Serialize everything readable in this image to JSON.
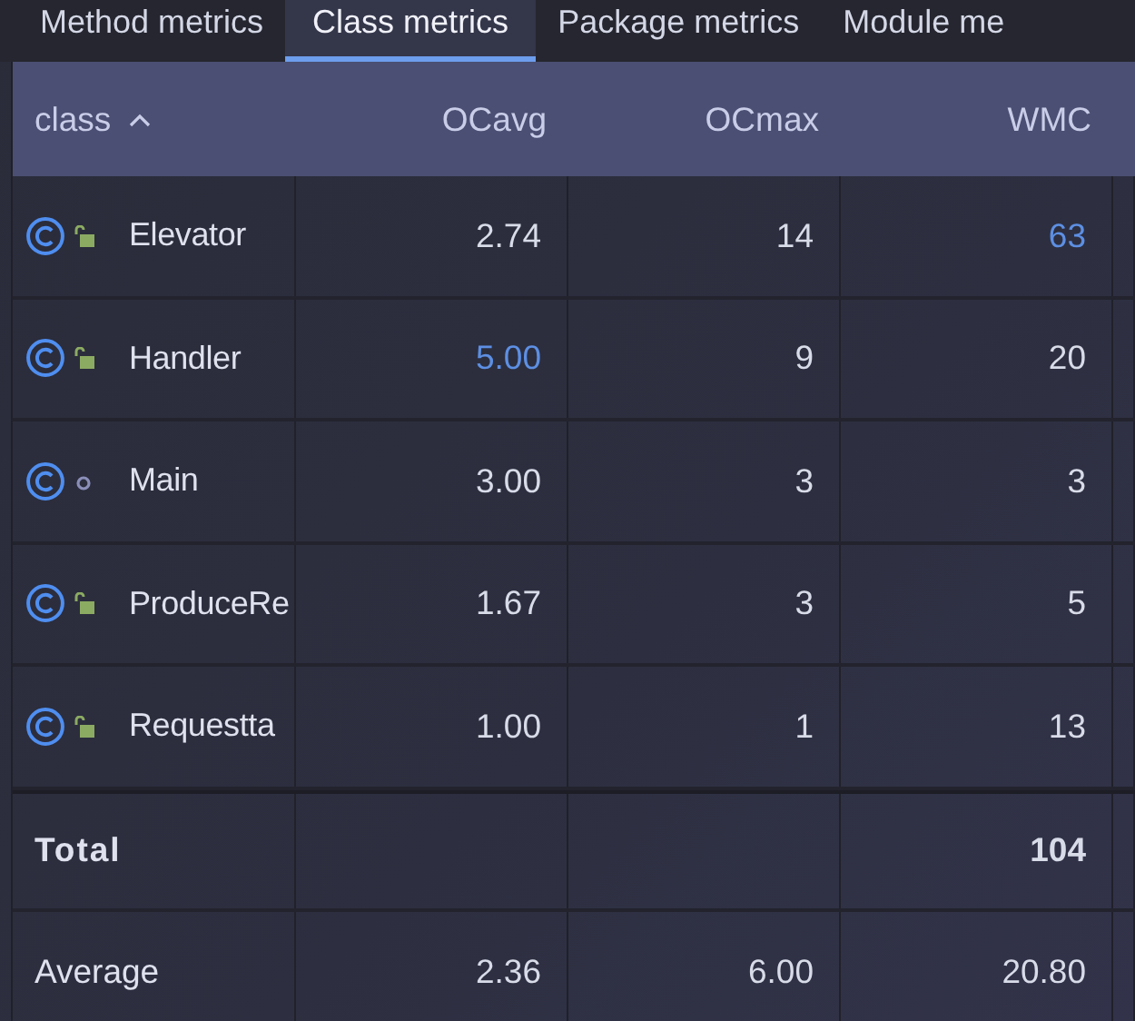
{
  "tabs": [
    {
      "label": "Method metrics",
      "selected": false
    },
    {
      "label": "Class metrics",
      "selected": true
    },
    {
      "label": "Package metrics",
      "selected": false
    },
    {
      "label": "Module me",
      "selected": false
    }
  ],
  "table": {
    "columns": [
      {
        "label": "class",
        "sorted": true
      },
      {
        "label": "OCavg"
      },
      {
        "label": "OCmax"
      },
      {
        "label": "WMC"
      }
    ],
    "rows": [
      {
        "name": "Elevator",
        "kind": "public",
        "values": [
          {
            "text": "2.74",
            "highlighted": false
          },
          {
            "text": "14",
            "highlighted": false
          },
          {
            "text": "63",
            "highlighted": true
          }
        ]
      },
      {
        "name": "Handler",
        "kind": "public",
        "values": [
          {
            "text": "5.00",
            "highlighted": true
          },
          {
            "text": "9",
            "highlighted": false
          },
          {
            "text": "20",
            "highlighted": false
          }
        ]
      },
      {
        "name": "Main",
        "kind": "package",
        "values": [
          {
            "text": "3.00",
            "highlighted": false
          },
          {
            "text": "3",
            "highlighted": false
          },
          {
            "text": "3",
            "highlighted": false
          }
        ]
      },
      {
        "name": "ProduceRe",
        "kind": "public",
        "values": [
          {
            "text": "1.67",
            "highlighted": false
          },
          {
            "text": "3",
            "highlighted": false
          },
          {
            "text": "5",
            "highlighted": false
          }
        ]
      },
      {
        "name": "Requestta",
        "kind": "public",
        "values": [
          {
            "text": "1.00",
            "highlighted": false
          },
          {
            "text": "1",
            "highlighted": false
          },
          {
            "text": "13",
            "highlighted": false
          }
        ]
      }
    ],
    "summary": [
      {
        "label": "Total",
        "bold": true,
        "wmc": "104"
      },
      {
        "label": "Average",
        "bold": false,
        "ocavg": "2.36",
        "ocmax": "6.00",
        "wmc": "20.80"
      }
    ]
  }
}
